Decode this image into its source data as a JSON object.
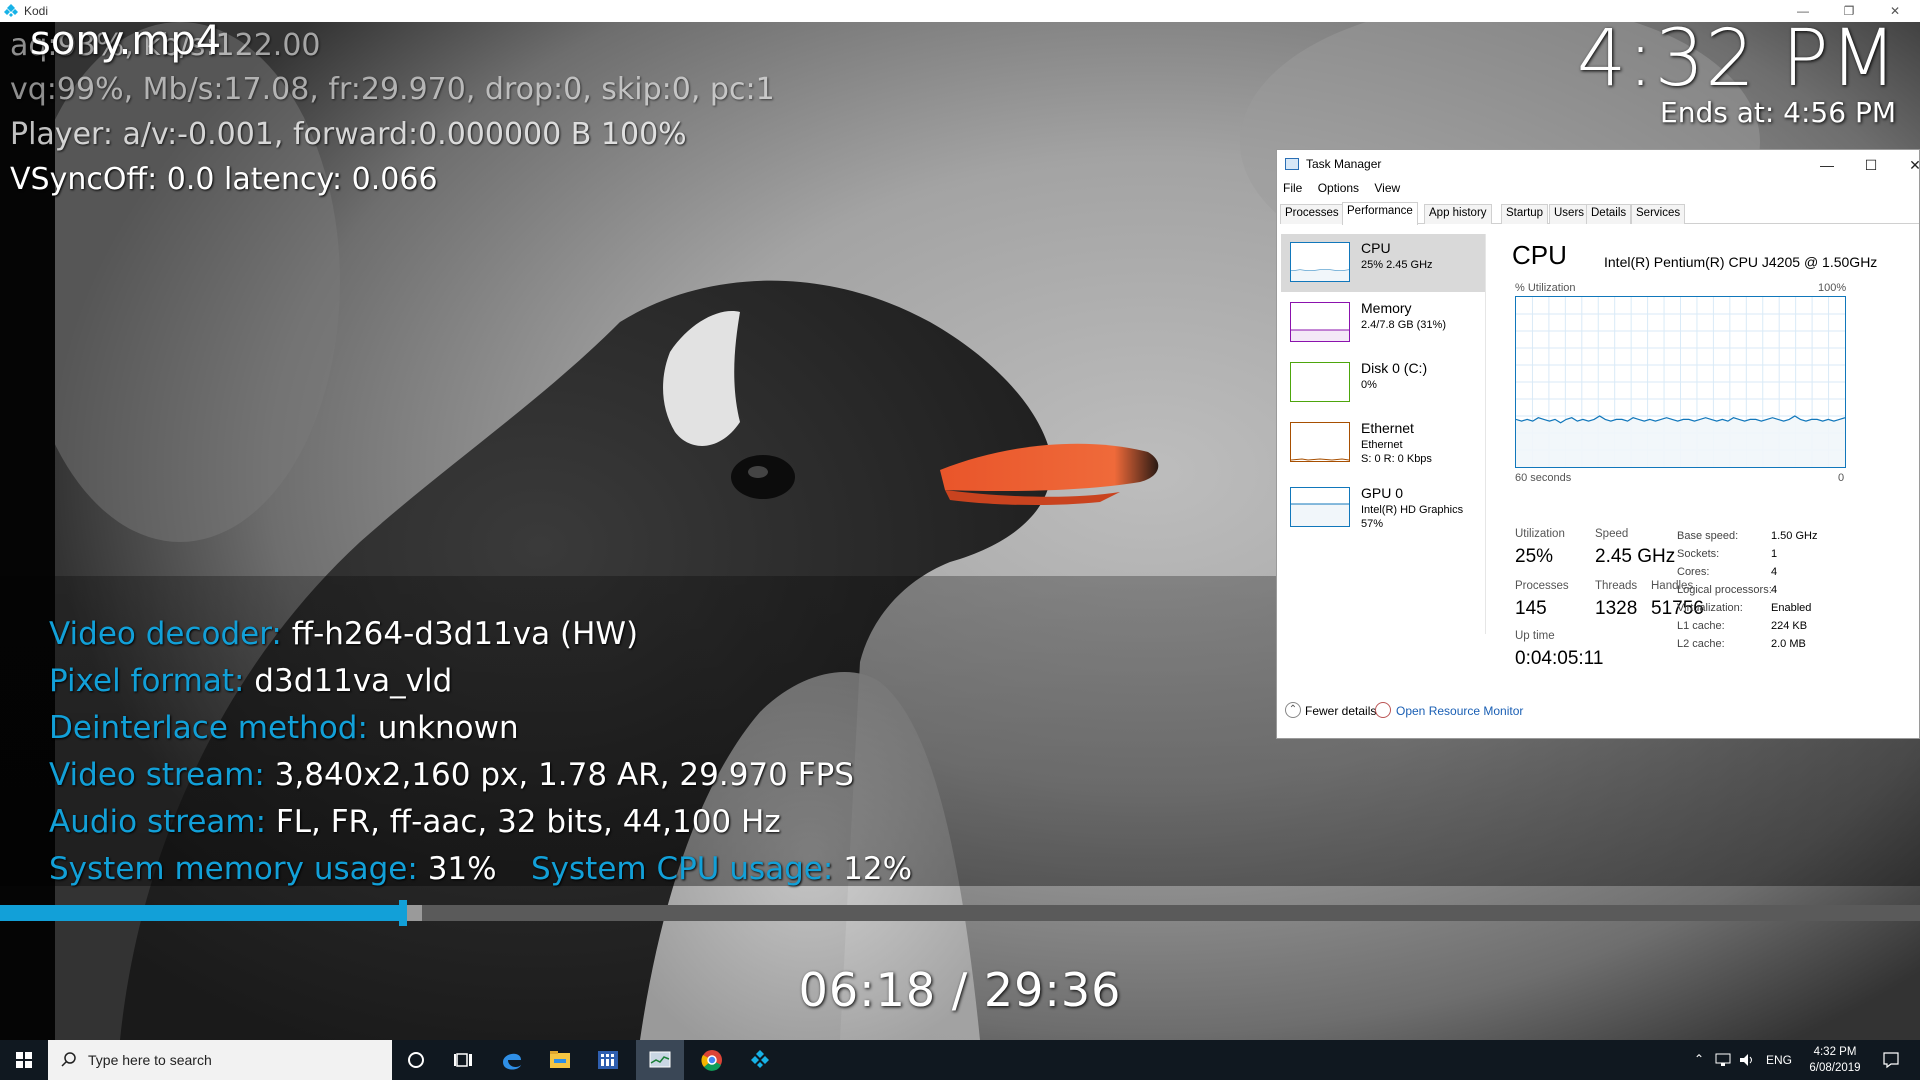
{
  "window": {
    "title": "Kodi"
  },
  "player": {
    "filename": "sony.mp4",
    "clock": "4:32 PM",
    "ends_at": "Ends at: 4:56 PM",
    "debug": {
      "aq": "aq:93%, kb/s:122.00",
      "vq": "vq:99%, Mb/s:17.08, fr:29.970, drop:0, skip:0, pc:1",
      "player": "Player: a/v:-0.001,  forward:0.000000 B 100%",
      "vsync": "VSyncOff: 0.0 latency: 0.066"
    },
    "codec_info": {
      "video_decoder": {
        "label": "Video decoder:",
        "value": "ff-h264-d3d11va (HW)"
      },
      "pixel_format": {
        "label": "Pixel format:",
        "value": "d3d11va_vld"
      },
      "deinterlace": {
        "label": "Deinterlace method:",
        "value": "unknown"
      },
      "video_stream": {
        "label": "Video stream:",
        "value": "3,840x2,160 px, 1.78 AR, 29.970 FPS"
      },
      "audio_stream": {
        "label": "Audio stream:",
        "value": "FL, FR, ff-aac, 32 bits, 44,100 Hz"
      },
      "memory": {
        "label": "System memory usage:",
        "value": "31%"
      },
      "cpu": {
        "label": "System CPU usage:",
        "value": "12%"
      }
    },
    "progress_fraction": 0.2098,
    "cache_fraction": 0.22,
    "timecode": "06:18 / 29:36"
  },
  "task_manager": {
    "title": "Task Manager",
    "menu": [
      "File",
      "Options",
      "View"
    ],
    "tabs": [
      "Processes",
      "Performance",
      "App history",
      "Startup",
      "Users",
      "Details",
      "Services"
    ],
    "active_tab": "Performance",
    "sidebar": [
      {
        "name": "CPU",
        "sub1": "25% 2.45 GHz",
        "sub2": "",
        "color": "#1177bb"
      },
      {
        "name": "Memory",
        "sub1": "2.4/7.8 GB (31%)",
        "sub2": "",
        "color": "#8b12ae"
      },
      {
        "name": "Disk 0 (C:)",
        "sub1": "0%",
        "sub2": "",
        "color": "#4da60c"
      },
      {
        "name": "Ethernet",
        "sub1": "Ethernet",
        "sub2": "S: 0 R: 0 Kbps",
        "color": "#a74f01"
      },
      {
        "name": "GPU 0",
        "sub1": "Intel(R) HD Graphics",
        "sub2": "57%",
        "color": "#1177bb"
      }
    ],
    "cpu": {
      "title": "CPU",
      "model": "Intel(R) Pentium(R) CPU J4205 @ 1.50GHz",
      "util_label": "% Utilization",
      "max_label": "100%",
      "time_label": "60 seconds",
      "min_label": "0",
      "utilization_label": "Utilization",
      "utilization": "25%",
      "speed_label": "Speed",
      "speed": "2.45 GHz",
      "processes_label": "Processes",
      "processes": "145",
      "threads_label": "Threads",
      "threads": "1328",
      "handles_label": "Handles",
      "handles": "51756",
      "uptime_label": "Up time",
      "uptime": "0:04:05:11",
      "specs": [
        {
          "k": "Base speed:",
          "v": "1.50 GHz"
        },
        {
          "k": "Sockets:",
          "v": "1"
        },
        {
          "k": "Cores:",
          "v": "4"
        },
        {
          "k": "Logical processors:",
          "v": "4"
        },
        {
          "k": "Virtualization:",
          "v": "Enabled"
        },
        {
          "k": "L1 cache:",
          "v": "224 KB"
        },
        {
          "k": "L2 cache:",
          "v": "2.0 MB"
        }
      ],
      "history_percent": [
        28,
        27,
        28,
        27,
        29,
        28,
        27,
        28,
        26,
        28,
        29,
        27,
        28,
        27,
        28,
        30,
        28,
        27,
        28,
        28,
        27,
        29,
        28,
        27,
        28,
        27,
        28,
        29,
        28,
        27,
        28,
        28,
        27,
        28,
        29,
        28,
        27,
        28,
        27,
        29,
        28,
        27,
        28,
        28,
        27,
        28,
        29,
        28,
        27,
        28,
        30,
        28,
        27,
        28,
        28,
        27,
        28,
        27,
        28,
        29
      ]
    },
    "footer": {
      "fewer": "Fewer details",
      "resource_monitor": "Open Resource Monitor"
    }
  },
  "taskbar": {
    "search_placeholder": "Type here to search",
    "lang": "ENG",
    "time": "4:32 PM",
    "date": "6/08/2019"
  }
}
